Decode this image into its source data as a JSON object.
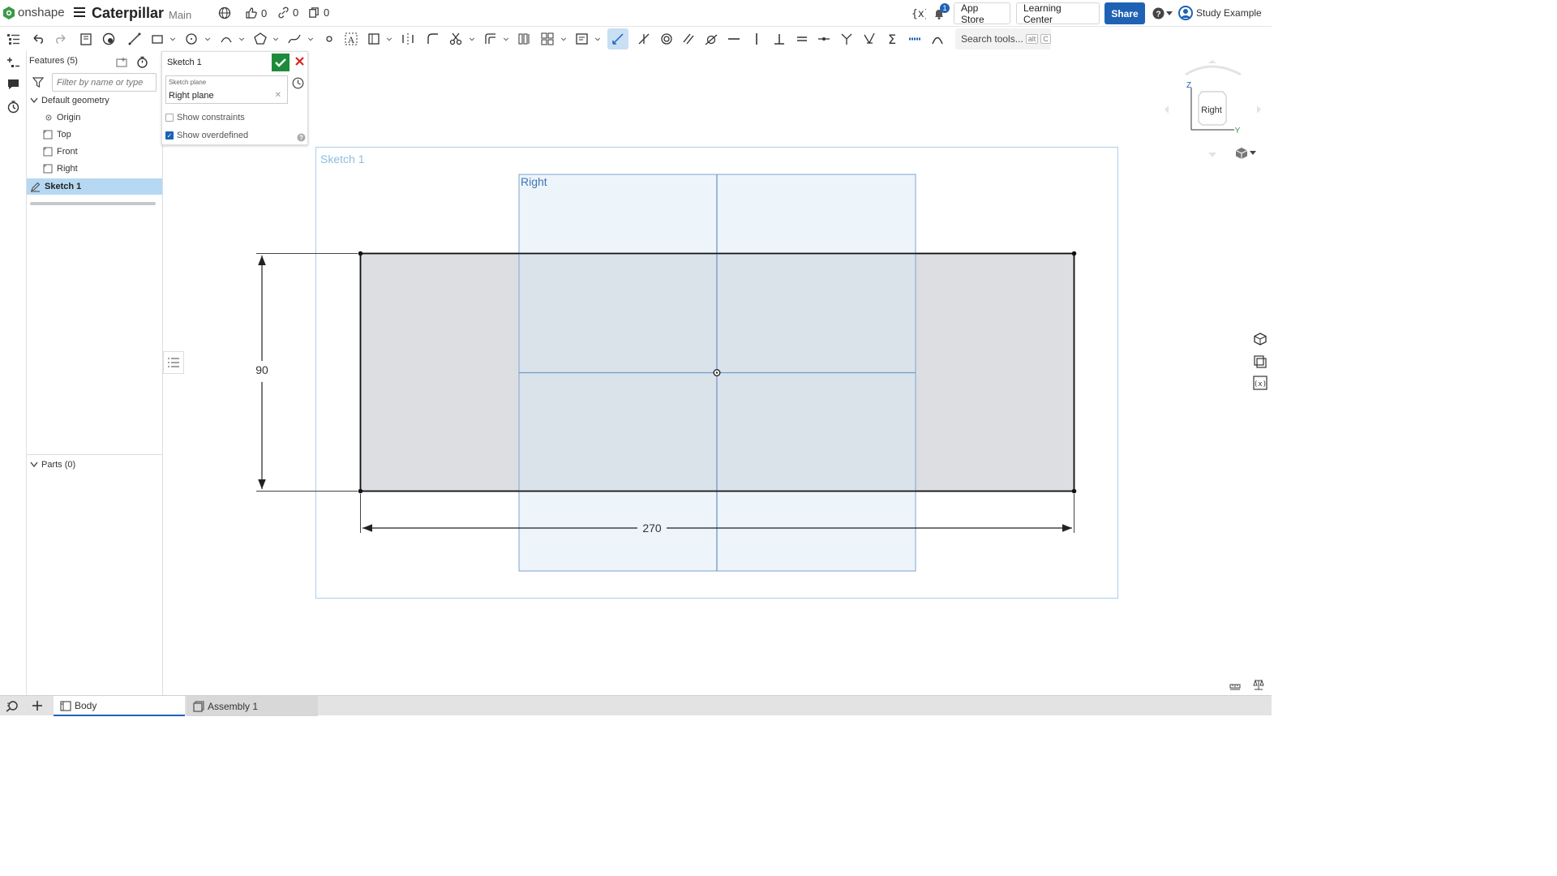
{
  "topbar": {
    "brand": "onshape",
    "doc_title": "Caterpillar",
    "branch": "Main",
    "likes": "0",
    "links": "0",
    "copies": "0",
    "notification_count": "1",
    "app_store": "App Store",
    "learning_center": "Learning Center",
    "share": "Share",
    "user_name": "Study Example"
  },
  "toolbar": {
    "search_placeholder": "Search tools...",
    "shortcut_alt": "alt",
    "shortcut_key": "C"
  },
  "features": {
    "header": "Features (5)",
    "filter_placeholder": "Filter by name or type",
    "default_geometry": "Default geometry",
    "items": [
      {
        "label": "Origin"
      },
      {
        "label": "Top"
      },
      {
        "label": "Front"
      },
      {
        "label": "Right"
      }
    ],
    "sketch": "Sketch 1",
    "parts": "Parts (0)"
  },
  "sketch_dialog": {
    "title": "Sketch 1",
    "plane_label": "Sketch plane",
    "plane_value": "Right plane",
    "show_constraints": "Show constraints",
    "show_overdefined": "Show overdefined",
    "show_constraints_checked": false,
    "show_overdefined_checked": true
  },
  "viewport": {
    "sketch_label": "Sketch 1",
    "plane_label": "Right",
    "dim_height": "90",
    "dim_width": "270",
    "viewcube_face": "Right",
    "axis_z": "Z",
    "axis_y": "Y"
  },
  "tabs": [
    {
      "label": "Body",
      "active": true
    },
    {
      "label": "Assembly 1",
      "active": false
    }
  ],
  "colors": {
    "accent": "#1f62b4",
    "ok": "#1e8b3a",
    "cancel": "#dd2222",
    "selection": "#b6d8f2",
    "plane_fill": "#eef4fa",
    "plane_stroke": "#7fa6cf",
    "sketch_fill": "#dde0e4"
  }
}
